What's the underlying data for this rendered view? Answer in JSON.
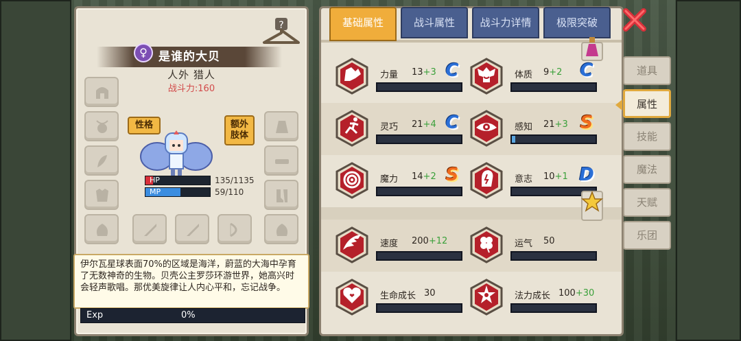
{
  "character": {
    "name": "是谁的大贝",
    "race": "人外 猎人",
    "power": "战斗力:160",
    "gender_icon": "female-symbol",
    "personality_label": "性格",
    "extra_limb_label": "额外\n肢体",
    "hp_label": "HP",
    "hp_value": "135/1135",
    "hp_fraction": 0.12,
    "mp_label": "MP",
    "mp_value": "59/110",
    "mp_fraction": 0.54,
    "description": "伊尔瓦星球表面70%的区域是海洋，蔚蓝的大海中孕育了无数神奇的生物。贝壳公主罗莎环游世界，她高兴时会轻声歌唱。那优美旋律让人内心平和，忘记战争。",
    "exp_label": "Exp",
    "exp_value": "0%"
  },
  "tabs": [
    "基础属性",
    "战斗属性",
    "战斗力详情",
    "极限突破"
  ],
  "side_tabs": [
    "道具",
    "属性",
    "技能",
    "魔法",
    "天赋",
    "乐团"
  ],
  "attributes": [
    {
      "name": "力量",
      "value": "13",
      "bonus": "+3",
      "grade": "C",
      "icon": "muscle-arm-icon",
      "fill": 0
    },
    {
      "name": "体质",
      "value": "9",
      "bonus": "+2",
      "grade": "C",
      "icon": "strong-body-icon",
      "fill": 0
    },
    {
      "name": "灵巧",
      "value": "21",
      "bonus": "+4",
      "grade": "C",
      "icon": "running-man-icon",
      "fill": 0
    },
    {
      "name": "感知",
      "value": "21",
      "bonus": "+3",
      "grade": "S",
      "icon": "eye-icon",
      "fill": 0.04
    },
    {
      "name": "魔力",
      "value": "14",
      "bonus": "+2",
      "grade": "S",
      "icon": "spiral-icon",
      "fill": 0
    },
    {
      "name": "意志",
      "value": "10",
      "bonus": "+1",
      "grade": "D",
      "icon": "head-bolt-icon",
      "fill": 0
    },
    {
      "name": "速度",
      "value": "200",
      "bonus": "+12",
      "grade": "",
      "icon": "wing-icon",
      "fill": 0
    },
    {
      "name": "运气",
      "value": "50",
      "bonus": "",
      "grade": "",
      "icon": "clover-icon",
      "fill": 0
    },
    {
      "name": "生命成长",
      "value": "30",
      "bonus": "",
      "grade": "",
      "icon": "heart-icon",
      "fill": 0
    },
    {
      "name": "法力成长",
      "value": "100",
      "bonus": "+30",
      "grade": "",
      "icon": "star-flame-icon",
      "fill": 0
    }
  ],
  "colors": {
    "panel_bg": "#e9e3d5",
    "tab_active": "#f0ad3b",
    "tab_inactive": "#4a5f8f",
    "bonus_green": "#3aa03a",
    "power_red": "#d24a4a",
    "icon_red": "#b5202a"
  }
}
